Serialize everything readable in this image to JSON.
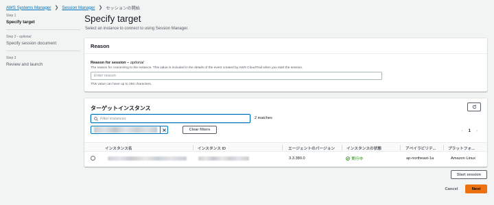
{
  "breadcrumb": {
    "items": [
      "AWS Systems Manager",
      "Session Manager"
    ],
    "current": "セッションの開始"
  },
  "steps": [
    {
      "number": "Step 1",
      "optional": "",
      "title": "Specify target",
      "active": true
    },
    {
      "number": "Step 2",
      "optional": "optional",
      "title": "Specify session document",
      "active": false
    },
    {
      "number": "Step 3",
      "optional": "",
      "title": "Review and launch",
      "active": false
    }
  ],
  "page": {
    "title": "Specify target",
    "description": "Select an instance to connect to using Session Manager."
  },
  "reason": {
    "header": "Reason",
    "label": "Reason for session",
    "label_optional": "optional",
    "description": "The reason for connecting to the instance. This value is included in the details of the event created by AWS CloudTrail when you start the session.",
    "placeholder": "Enter reason",
    "constraint": "This value can have up to 256 characters."
  },
  "targets": {
    "title": "ターゲットインスタンス",
    "filter_placeholder": "Filter instances",
    "matches": "2 matches",
    "clear_filters": "Clear filters",
    "page": "1",
    "columns": [
      "インスタンス名",
      "インスタンス ID",
      "エージェントのバージョン",
      "インスタンスの状態",
      "アベイラビリテ...",
      "プラットフォ..."
    ],
    "rows": [
      {
        "agent_version": "3.3.380.0",
        "state": "実行中",
        "availability_zone": "ap-northeast-1a",
        "platform": "Amazon Linux"
      }
    ]
  },
  "actions": {
    "start_session": "Start session",
    "cancel": "Cancel",
    "next": "Next"
  },
  "colors": {
    "link": "#0073bb",
    "primary": "#ec7211",
    "success": "#1d8102"
  },
  "icons": [
    "chevron-right-icon",
    "search-icon",
    "close-icon",
    "refresh-icon",
    "chevron-left-icon",
    "check-circle-icon"
  ]
}
